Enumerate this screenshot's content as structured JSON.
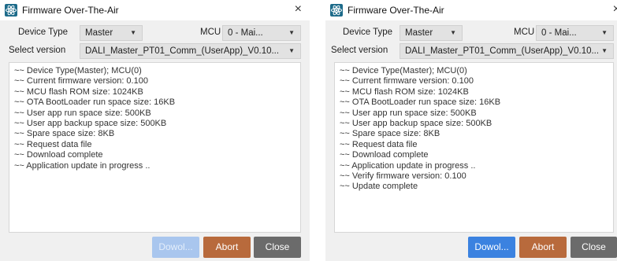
{
  "dialog_title": "Firmware Over-The-Air",
  "close_glyph": "×",
  "labels": {
    "device_type": "Device Type",
    "mcu": "MCU",
    "select_version": "Select version"
  },
  "combos": {
    "device_type": "Master",
    "mcu": "0 - Mai...",
    "version": "DALI_Master_PT01_Comm_(UserApp)_V0.10..."
  },
  "dropdown_arrow": "▼",
  "log_left": [
    "~~ Device Type(Master); MCU(0)",
    "~~ Current firmware version: 0.100",
    "~~ MCU flash ROM size: 1024KB",
    "~~ OTA BootLoader run space size: 16KB",
    "~~ User app run space size: 500KB",
    "~~ User app backup space size: 500KB",
    "~~ Spare space size: 8KB",
    "~~ Request data file",
    "~~ Download complete",
    "~~ Application update in progress .."
  ],
  "log_right": [
    "~~ Device Type(Master); MCU(0)",
    "~~ Current firmware version: 0.100",
    "~~ MCU flash ROM size: 1024KB",
    "~~ OTA BootLoader run space size: 16KB",
    "~~ User app run space size: 500KB",
    "~~ User app backup space size: 500KB",
    "~~ Spare space size: 8KB",
    "~~ Request data file",
    "~~ Download complete",
    "~~ Application update in progress ..",
    "~~ Verify firmware version: 0.100",
    "~~ Update complete"
  ],
  "buttons": {
    "download": "Dowol...",
    "abort": "Abort",
    "close": "Close"
  },
  "button_states": {
    "left_download_enabled": false,
    "right_download_enabled": true
  },
  "colors": {
    "blue": "#3b82e0",
    "blue_disabled": "#a9c6ee",
    "brown": "#b86a3c",
    "gray": "#6b6b6b"
  },
  "icons": {
    "app": "atom-icon",
    "close": "close-icon",
    "dropdown": "chevron-down-icon"
  }
}
